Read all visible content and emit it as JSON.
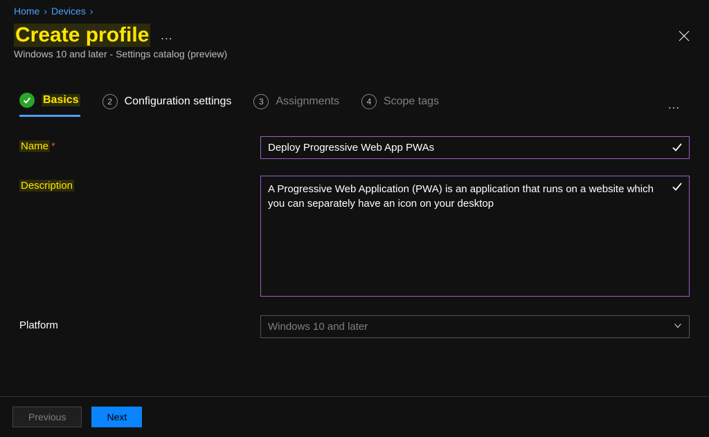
{
  "breadcrumb": {
    "home": "Home",
    "devices": "Devices"
  },
  "header": {
    "title": "Create profile",
    "subtitle": "Windows 10 and later - Settings catalog (preview)"
  },
  "tabs": {
    "basics": "Basics",
    "config_num": "2",
    "config": "Configuration settings",
    "assign_num": "3",
    "assign": "Assignments",
    "scope_num": "4",
    "scope": "Scope tags"
  },
  "form": {
    "name_label": "Name",
    "name_value": "Deploy Progressive Web App PWAs",
    "desc_label": "Description",
    "desc_value": "A Progressive Web Application (PWA) is an application that runs on a website which you can separately have an icon on your desktop",
    "platform_label": "Platform",
    "platform_value": "Windows 10 and later"
  },
  "footer": {
    "previous": "Previous",
    "next": "Next"
  }
}
